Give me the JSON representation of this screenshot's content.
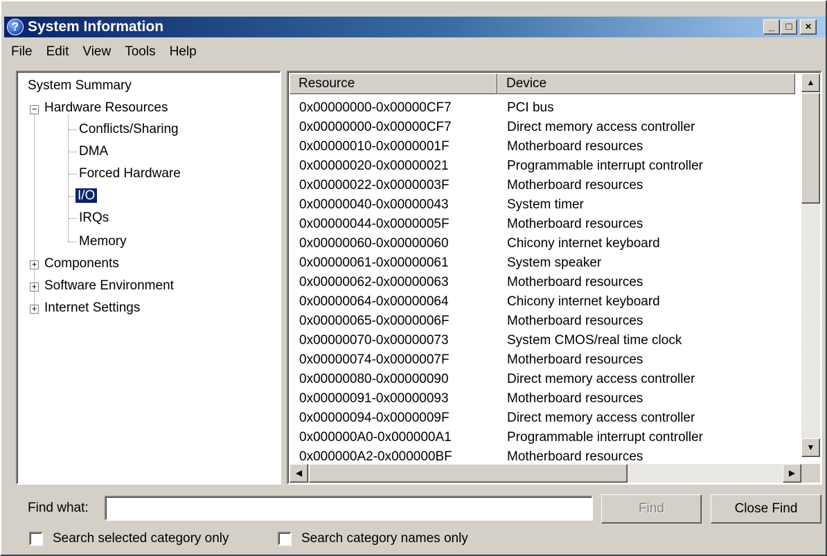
{
  "window": {
    "title": "System Information",
    "icon": "question-help-icon",
    "controls": {
      "minimize": "_",
      "maximize": "□",
      "close": "×"
    }
  },
  "menu": [
    "File",
    "Edit",
    "View",
    "Tools",
    "Help"
  ],
  "tree": {
    "root": "System Summary",
    "hardware": "Hardware Resources",
    "hardware_children": [
      "Conflicts/Sharing",
      "DMA",
      "Forced Hardware",
      "I/O",
      "IRQs",
      "Memory"
    ],
    "selected": "I/O",
    "collapsed": [
      "Components",
      "Software Environment",
      "Internet Settings"
    ]
  },
  "list": {
    "columns": {
      "resource": "Resource",
      "device": "Device"
    },
    "rows": [
      {
        "resource": "0x00000000-0x00000CF7",
        "device": "PCI bus"
      },
      {
        "resource": "0x00000000-0x00000CF7",
        "device": "Direct memory access controller"
      },
      {
        "resource": "0x00000010-0x0000001F",
        "device": "Motherboard resources"
      },
      {
        "resource": "0x00000020-0x00000021",
        "device": "Programmable interrupt controller"
      },
      {
        "resource": "0x00000022-0x0000003F",
        "device": "Motherboard resources"
      },
      {
        "resource": "0x00000040-0x00000043",
        "device": "System timer"
      },
      {
        "resource": "0x00000044-0x0000005F",
        "device": "Motherboard resources"
      },
      {
        "resource": "0x00000060-0x00000060",
        "device": "Chicony internet keyboard"
      },
      {
        "resource": "0x00000061-0x00000061",
        "device": "System speaker"
      },
      {
        "resource": "0x00000062-0x00000063",
        "device": "Motherboard resources"
      },
      {
        "resource": "0x00000064-0x00000064",
        "device": "Chicony internet keyboard"
      },
      {
        "resource": "0x00000065-0x0000006F",
        "device": "Motherboard resources"
      },
      {
        "resource": "0x00000070-0x00000073",
        "device": "System CMOS/real time clock"
      },
      {
        "resource": "0x00000074-0x0000007F",
        "device": "Motherboard resources"
      },
      {
        "resource": "0x00000080-0x00000090",
        "device": "Direct memory access controller"
      },
      {
        "resource": "0x00000091-0x00000093",
        "device": "Motherboard resources"
      },
      {
        "resource": "0x00000094-0x0000009F",
        "device": "Direct memory access controller"
      },
      {
        "resource": "0x000000A0-0x000000A1",
        "device": "Programmable interrupt controller"
      },
      {
        "resource": "0x000000A2-0x000000BF",
        "device": "Motherboard resources"
      }
    ]
  },
  "find": {
    "label": "Find what:",
    "value": "",
    "find_button": "Find",
    "close_button": "Close Find",
    "option_selected_category": "Search selected category only",
    "option_category_names": "Search category names only"
  },
  "colors": {
    "title_start": "#0a246a",
    "title_end": "#a6caf0",
    "face": "#d4d0c8",
    "selection": "#0a246a"
  }
}
